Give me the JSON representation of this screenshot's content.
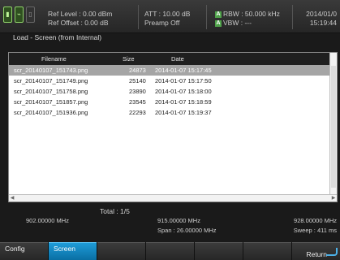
{
  "status": {
    "ref_level": "Ref Level : 0.00 dBm",
    "ref_offset": "Ref Offset : 0.00 dB",
    "att": "ATT : 10.00 dB",
    "preamp": "Preamp Off",
    "rbw": "RBW : 50.000 kHz",
    "vbw": "VBW : ---",
    "date": "2014/01/0",
    "time": "15:19:44"
  },
  "panel": {
    "title": "Load - Screen (from Internal)",
    "columns": {
      "filename": "Filename",
      "size": "Size",
      "date": "Date"
    },
    "files": [
      {
        "name": "scr_20140107_151743.png",
        "size": "24873",
        "date": "2014-01-07 15:17:45",
        "selected": true
      },
      {
        "name": "scr_20140107_151749.png",
        "size": "25140",
        "date": "2014-01-07 15:17:50",
        "selected": false
      },
      {
        "name": "scr_20140107_151758.png",
        "size": "23890",
        "date": "2014-01-07 15:18:00",
        "selected": false
      },
      {
        "name": "scr_20140107_151857.png",
        "size": "23545",
        "date": "2014-01-07 15:18:59",
        "selected": false
      },
      {
        "name": "scr_20140107_151936.png",
        "size": "22293",
        "date": "2014-01-07 15:19:37",
        "selected": false
      }
    ],
    "total": "Total : 1/5"
  },
  "freq": {
    "start": "902.00000 MHz",
    "center": "915.00000 MHz",
    "span": "Span : 26.00000 MHz",
    "stop": "928.00000 MHz",
    "sweep": "Sweep : 411 ms"
  },
  "softkeys": [
    "Config",
    "Screen",
    "",
    "",
    "",
    "",
    "Return"
  ]
}
